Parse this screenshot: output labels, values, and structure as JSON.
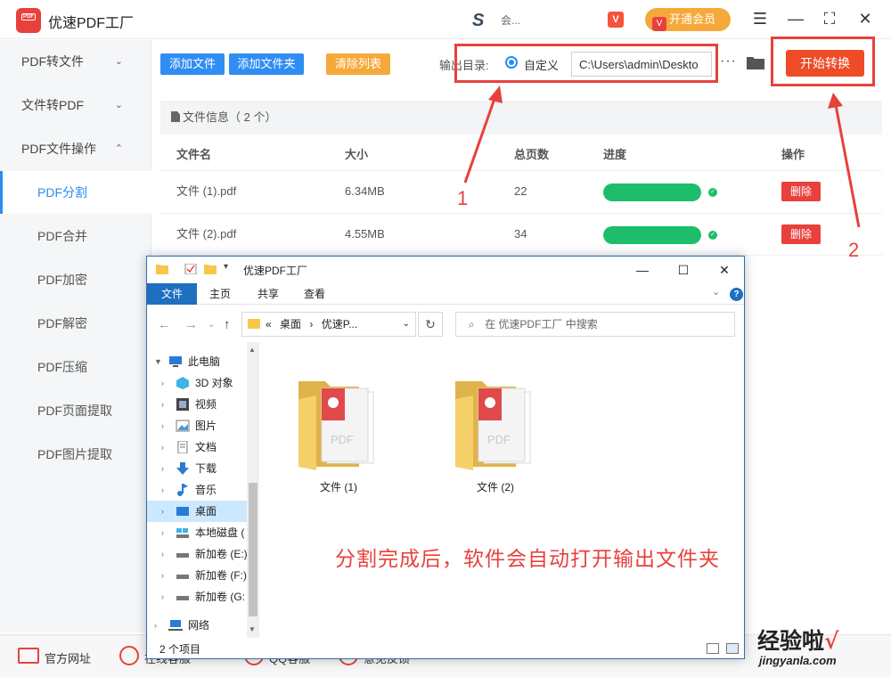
{
  "app": {
    "title": "优速PDF工厂",
    "logo_text": "PDF",
    "user_name": "会...",
    "vip_label": "开通会员",
    "colors": {
      "brand": "#e8413c",
      "primary": "#2f8df3",
      "accent": "#f6a93a",
      "success": "#1dbd6a",
      "start": "#ee4b27"
    }
  },
  "sidebar": {
    "groups": [
      {
        "label": "PDF转文件",
        "expanded": false
      },
      {
        "label": "文件转PDF",
        "expanded": false
      },
      {
        "label": "PDF文件操作",
        "expanded": true
      }
    ],
    "items": [
      {
        "label": "PDF分割",
        "active": true
      },
      {
        "label": "PDF合并"
      },
      {
        "label": "PDF加密"
      },
      {
        "label": "PDF解密"
      },
      {
        "label": "PDF压缩"
      },
      {
        "label": "PDF页面提取"
      },
      {
        "label": "PDF图片提取"
      }
    ]
  },
  "toolbar": {
    "add_file": "添加文件",
    "add_folder": "添加文件夹",
    "clear_list": "清除列表",
    "output_label": "输出目录:",
    "radio_label": "自定义",
    "output_path": "C:\\Users\\admin\\Deskto",
    "more": "···",
    "start": "开始转换"
  },
  "file_list": {
    "header": "文件信息（ 2 个）",
    "columns": [
      "文件名",
      "大小",
      "总页数",
      "进度",
      "操作"
    ],
    "rows": [
      {
        "name": "文件 (1).pdf",
        "size": "6.34MB",
        "pages": "22",
        "progress": 1.0,
        "action": "删除"
      },
      {
        "name": "文件 (2).pdf",
        "size": "4.55MB",
        "pages": "34",
        "progress": 1.0,
        "action": "删除"
      }
    ]
  },
  "annotations": {
    "num1": "1",
    "num2": "2",
    "caption": "分割完成后，软件会自动打开输出文件夹"
  },
  "explorer": {
    "title": "优速PDF工厂",
    "ribbon": [
      "文件",
      "主页",
      "共享",
      "查看"
    ],
    "address": [
      "«",
      "桌面",
      "›",
      "优速P..."
    ],
    "search_placeholder": "在 优速PDF工厂 中搜索",
    "tree": [
      {
        "label": "此电脑",
        "icon": "computer-icon",
        "expanded": true
      },
      {
        "label": "3D 对象",
        "icon": "cube-icon"
      },
      {
        "label": "视频",
        "icon": "video-icon"
      },
      {
        "label": "图片",
        "icon": "picture-icon"
      },
      {
        "label": "文档",
        "icon": "document-icon"
      },
      {
        "label": "下载",
        "icon": "download-icon"
      },
      {
        "label": "音乐",
        "icon": "music-icon"
      },
      {
        "label": "桌面",
        "icon": "desktop-icon",
        "selected": true
      },
      {
        "label": "本地磁盘 (",
        "icon": "disk-icon"
      },
      {
        "label": "新加卷 (E:)",
        "icon": "drive-icon"
      },
      {
        "label": "新加卷 (F:)",
        "icon": "drive-icon"
      },
      {
        "label": "新加卷 (G:",
        "icon": "drive-icon"
      },
      {
        "label": "网络",
        "icon": "network-icon"
      }
    ],
    "folders": [
      {
        "label": "文件 (1)"
      },
      {
        "label": "文件 (2)"
      }
    ],
    "status": "2 个项目"
  },
  "bottombar": {
    "links": [
      "官方网址",
      "在线客服",
      "QQ客服",
      "意见反馈"
    ]
  },
  "watermark": {
    "text": "经验啦",
    "check": "√",
    "url": "jingyanla.com"
  }
}
